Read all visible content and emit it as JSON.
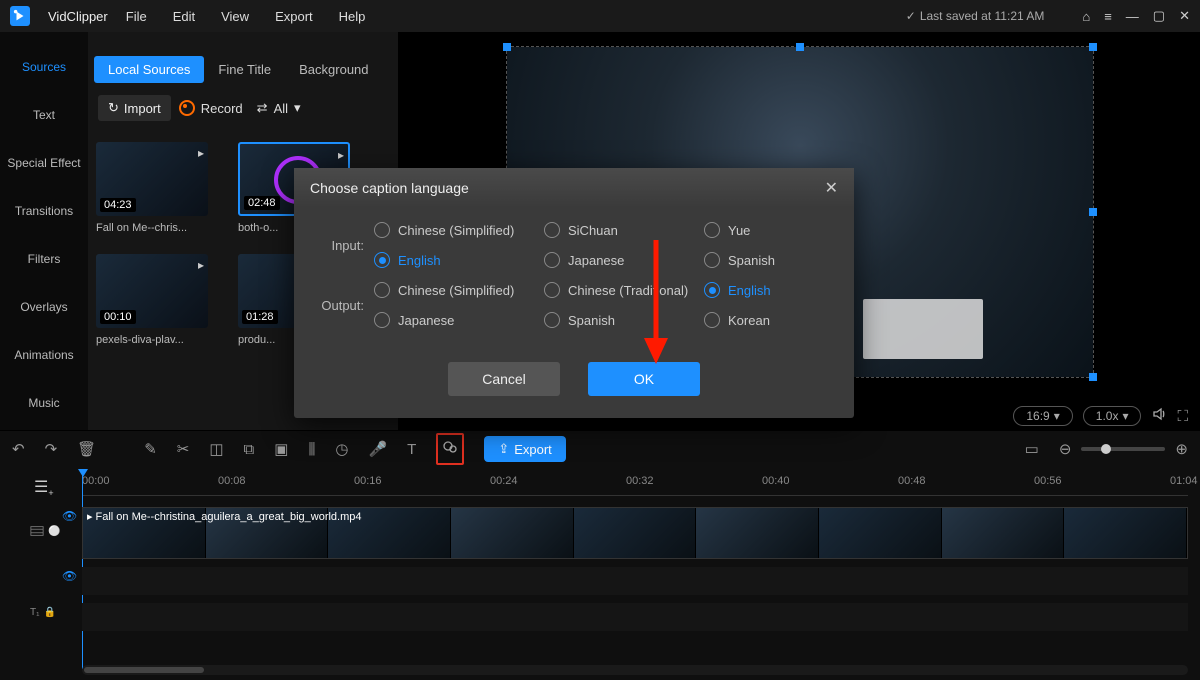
{
  "app": {
    "name": "VidClipper",
    "save_status": "Last saved at 11:21 AM"
  },
  "menu": [
    "File",
    "Edit",
    "View",
    "Export",
    "Help"
  ],
  "sidenav": [
    {
      "label": "Sources",
      "active": true
    },
    {
      "label": "Text"
    },
    {
      "label": "Special Effect"
    },
    {
      "label": "Transitions"
    },
    {
      "label": "Filters"
    },
    {
      "label": "Overlays"
    },
    {
      "label": "Animations"
    },
    {
      "label": "Music"
    }
  ],
  "panel": {
    "tabs": [
      {
        "label": "Local Sources",
        "active": true
      },
      {
        "label": "Fine Title"
      },
      {
        "label": "Background"
      }
    ],
    "import": "Import",
    "record": "Record",
    "sort": "All",
    "thumbs": [
      {
        "dur": "04:23",
        "name": "Fall on Me--chris..."
      },
      {
        "dur": "02:48",
        "name": "both-o...",
        "selected": true,
        "ring": true
      },
      {
        "dur": "00:10",
        "name": "pexels-diva-plav..."
      },
      {
        "dur": "01:28",
        "name": "produ..."
      }
    ]
  },
  "preview": {
    "aspect": "16:9",
    "speed": "1.0x"
  },
  "dialog": {
    "title": "Choose caption language",
    "input_label": "Input:",
    "output_label": "Output:",
    "input_options": [
      {
        "label": "Chinese (Simplified)"
      },
      {
        "label": "SiChuan"
      },
      {
        "label": "Yue"
      },
      {
        "label": "English",
        "selected": true
      },
      {
        "label": "Japanese"
      },
      {
        "label": "Spanish"
      }
    ],
    "output_options": [
      {
        "label": "Chinese (Simplified)"
      },
      {
        "label": "Chinese (Traditional)"
      },
      {
        "label": "English",
        "selected": true
      },
      {
        "label": "Japanese"
      },
      {
        "label": "Spanish"
      },
      {
        "label": "Korean"
      }
    ],
    "cancel": "Cancel",
    "ok": "OK"
  },
  "toolbar": {
    "export": "Export"
  },
  "timeline": {
    "ticks": [
      "00:00",
      "00:08",
      "00:16",
      "00:24",
      "00:32",
      "00:40",
      "00:48",
      "00:56",
      "01:04"
    ],
    "clip_name": "Fall on Me--christina_aguilera_a_great_big_world.mp4"
  }
}
